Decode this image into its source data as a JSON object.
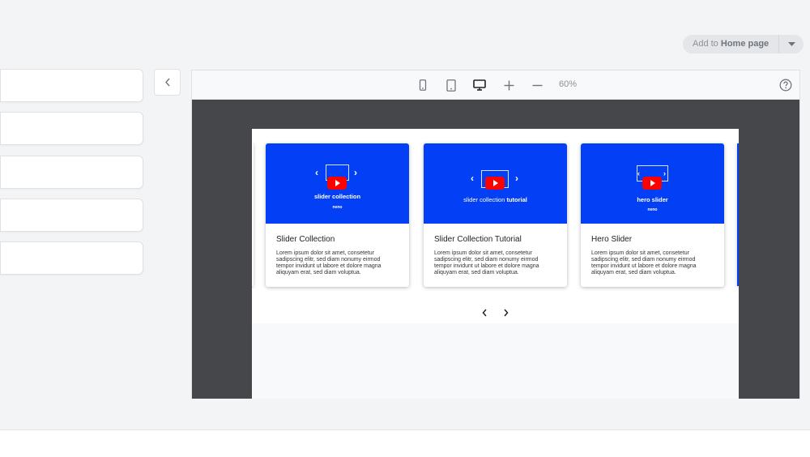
{
  "header": {
    "add_to_prefix": "Add to",
    "add_to_target": "Home page"
  },
  "sidebar": {
    "block_items": [
      {
        "id": "block-1"
      },
      {
        "id": "block-2"
      },
      {
        "id": "block-3"
      },
      {
        "id": "block-4"
      },
      {
        "id": "block-5"
      }
    ]
  },
  "toolbar": {
    "icons": [
      "mobile-icon",
      "tablet-icon",
      "desktop-icon",
      "zoom-in-icon",
      "zoom-out-icon",
      "help-icon"
    ],
    "zoom_level": "60%"
  },
  "slider": {
    "cards": [
      {
        "thumb_title": "slider collection",
        "thumb_brand": "neno",
        "title": "Slider Collection",
        "text": "Lorem ipsum dolor sit amet, consetetur sadipscing elitr, sed diam nonumy eirmod tempor invidunt ut labore et dolore magna aliquyam erat, sed diam voluptua."
      },
      {
        "thumb_title_light": "slider collection",
        "thumb_title_bold": "tutorial",
        "title": "Slider Collection Tutorial",
        "text": "Lorem ipsum dolor sit amet, consetetur sadipscing elitr, sed diam nonumy eirmod tempor invidunt ut labore et dolore magna aliquyam erat, sed diam voluptua."
      },
      {
        "thumb_title": "hero slider",
        "thumb_brand": "neno",
        "title": "Hero Slider",
        "text": "Lorem ipsum dolor sit amet, consetetur sadipscing elitr, sed diam nonumy eirmod tempor invidunt ut labore et dolore magna aliquyam erat, sed diam voluptua."
      }
    ],
    "nav_icons": [
      "chevron-left-icon",
      "chevron-right-icon"
    ]
  },
  "colors": {
    "card_blue": "#0340f5",
    "youtube_red": "#ff0000",
    "canvas_dark": "#46474a"
  }
}
